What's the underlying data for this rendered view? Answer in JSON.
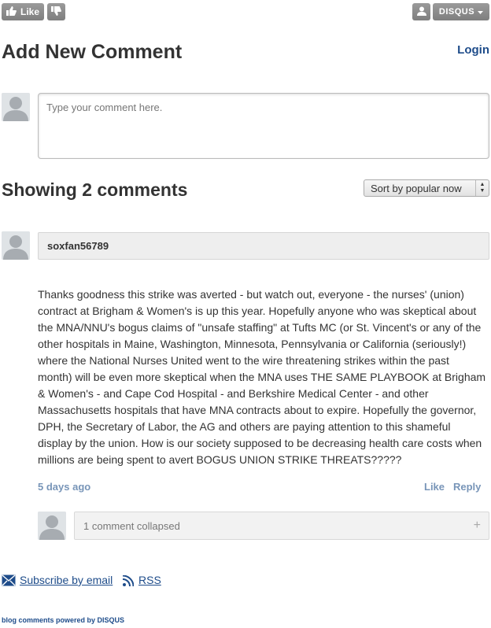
{
  "toolbar": {
    "like_label": "Like",
    "thumbs_up_icon": "thumbs-up-icon",
    "thumbs_down_icon": "thumbs-down-icon",
    "user_icon": "user-icon",
    "disqus_label": "DISQUS",
    "dropdown_icon": "caret-down-icon"
  },
  "add_comment": {
    "title": "Add New Comment",
    "login_label": "Login",
    "placeholder": "Type your comment here."
  },
  "comments_section": {
    "title": "Showing 2 comments",
    "sort_selected": "Sort by popular now"
  },
  "comments": [
    {
      "author": "soxfan56789",
      "text": "Thanks goodness this strike was averted - but watch out, everyone - the nurses' (union) contract at Brigham & Women's is up this year. Hopefully anyone who was skeptical about the MNA/NNU's bogus claims of \"unsafe staffing\" at Tufts MC (or St. Vincent's or any of the other hospitals in Maine, Washington, Minnesota, Pennsylvania or California (seriously!) where the National Nurses United went to the wire threatening strikes within the past month) will be even more skeptical when the MNA uses THE SAME PLAYBOOK at Brigham & Women's - and Cape Cod Hospital - and Berkshire Medical Center - and other Massachusetts hospitals that have MNA contracts about to expire. Hopefully the governor, DPH, the Secretary of Labor, the AG and others are paying attention to this shameful display by the union. How is our society supposed to be decreasing health care costs when millions are being spent to avert BOGUS UNION STRIKE THREATS?????",
      "timestamp": "5 days ago",
      "like_label": "Like",
      "reply_label": "Reply",
      "collapsed_label": "1 comment collapsed",
      "expand_symbol": "+"
    }
  ],
  "footer": {
    "subscribe_label": "Subscribe by email",
    "rss_label": "RSS",
    "powered_by": "blog comments powered by DISQUS"
  },
  "colors": {
    "link": "#1e4c8a",
    "meta": "#7895b8",
    "button_gray": "#8a8a8a"
  }
}
